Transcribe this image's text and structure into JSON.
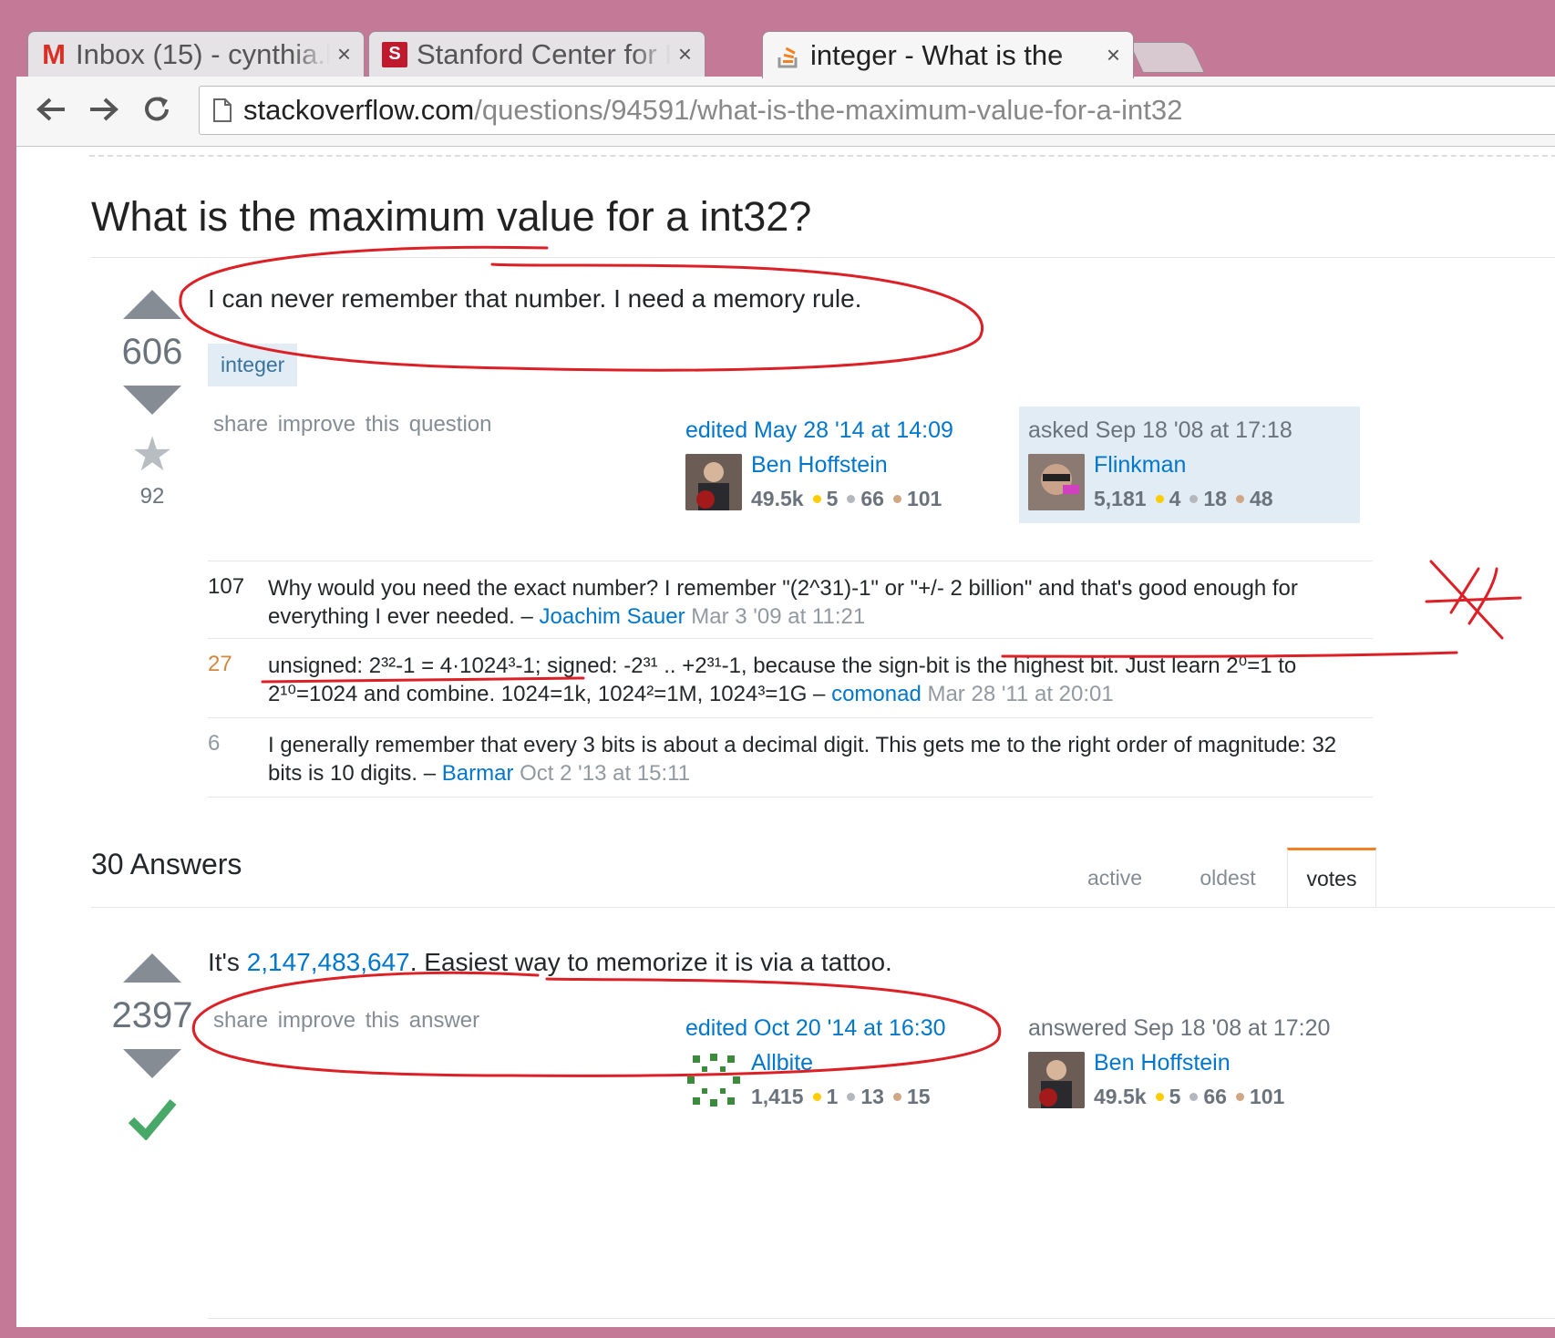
{
  "browser": {
    "tabs": [
      {
        "label": "Inbox (15) - cynthia.b",
        "close": "×"
      },
      {
        "label": "Stanford Center for P",
        "close": "×"
      },
      {
        "label": "integer - What is the",
        "close": "×"
      }
    ],
    "url_host": "stackoverflow.com",
    "url_path": "/questions/94591/what-is-the-maximum-value-for-a-int32"
  },
  "question": {
    "title": "What is the maximum value for a int32?",
    "body": "I can never remember that number. I need a memory rule.",
    "score": "606",
    "favorites": "92",
    "tag": "integer",
    "menu": "share improve this question",
    "edited": {
      "label": "edited May 28 '14 at 14:09",
      "user": "Ben Hoffstein",
      "rep": "49.5k",
      "gold": "5",
      "silver": "66",
      "bronze": "101"
    },
    "asked": {
      "label": "asked Sep 18 '08 at 17:18",
      "user": "Flinkman",
      "rep": "5,181",
      "gold": "4",
      "silver": "18",
      "bronze": "48"
    }
  },
  "comments": [
    {
      "score": "107",
      "text": "Why would you need the exact number? I remember \"(2^31)-1\" or \"+/- 2 billion\" and that's good enough for everything I ever needed. –",
      "user": "Joachim Sauer",
      "date": "Mar 3 '09 at 11:21",
      "score_color": "#242729"
    },
    {
      "score": "27",
      "text": "unsigned: 2³²-1 = 4·1024³-1; signed: -2³¹ .. +2³¹-1, because the sign-bit is the highest bit. Just learn 2⁰=1 to 2¹⁰=1024 and combine. 1024=1k, 1024²=1M, 1024³=1G –",
      "user": "comonad",
      "date": "Mar 28 '11 at 20:01",
      "score_color": "#d1883f"
    },
    {
      "score": "6",
      "text": "I generally remember that every 3 bits is about a decimal digit. This gets me to the right order of magnitude: 32 bits is 10 digits. –",
      "user": "Barmar",
      "date": "Oct 2 '13 at 15:11",
      "score_color": "#9199a1"
    }
  ],
  "answers": {
    "header": "30 Answers",
    "sort_tabs": [
      "active",
      "oldest",
      "votes"
    ],
    "top": {
      "score": "2397",
      "text_before": "It's ",
      "number": "2,147,483,647",
      "text_after": ". Easiest way to memorize it is via a tattoo.",
      "menu": "share improve this answer",
      "edited": {
        "label": "edited Oct 20 '14 at 16:30",
        "user": "Allbite",
        "rep": "1,415",
        "gold": "1",
        "silver": "13",
        "bronze": "15"
      },
      "answered": {
        "label": "answered Sep 18 '08 at 17:20",
        "user": "Ben Hoffstein",
        "rep": "49.5k",
        "gold": "5",
        "silver": "66",
        "bronze": "101"
      }
    }
  },
  "colors": {
    "annotation": "#dd1f26",
    "accepted": "#48a868",
    "window_frame": "#c47a96"
  }
}
